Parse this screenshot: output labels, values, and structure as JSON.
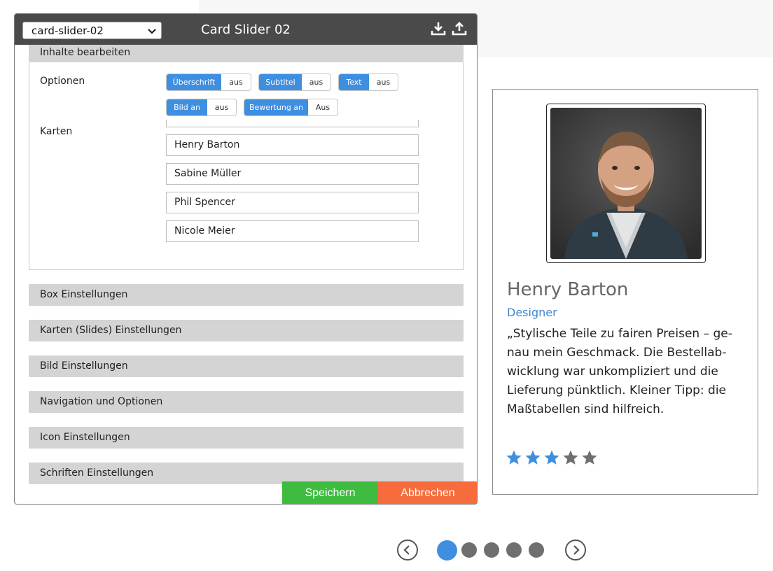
{
  "editor": {
    "preset_select": "card-slider-02",
    "title": "Card Slider 02",
    "sections": {
      "content": "Inhalte bearbeiten",
      "box": "Box Einstellungen",
      "slides": "Karten (Slides) Einstellungen",
      "image": "Bild Einstellungen",
      "navigation": "Navigation und Optionen",
      "icon": "Icon Einstellungen",
      "fonts": "Schriften Einstellungen"
    },
    "options_label": "Optionen",
    "cards_label": "Karten",
    "toggles": [
      {
        "on": "Überschrift",
        "off": "aus"
      },
      {
        "on": "Subtitel",
        "off": "aus"
      },
      {
        "on": "Text",
        "off": "aus"
      },
      {
        "on": "Bild an",
        "off": "aus"
      },
      {
        "on": "Bewertung an",
        "off": "Aus"
      }
    ],
    "cards": [
      "Henry Barton",
      "Sabine Müller",
      "Phil Spencer",
      "Nicole Meier"
    ],
    "save_label": "Speichern",
    "cancel_label": "Abbrechen"
  },
  "preview": {
    "name": "Henry Barton",
    "role": "Designer",
    "quote": "„Stylische Teile zu fairen Preisen – ge­nau mein Geschmack. Die Bestellab­wicklung war unkompliziert und die Lieferung pünktlich. Kleiner Tipp: die Maßtabellen sind hilfreich.",
    "rating": 3,
    "rating_max": 5
  },
  "slider": {
    "dot_count": 5,
    "active_index": 0
  },
  "colors": {
    "accent": "#3f8fe0",
    "save": "#3fbc3f",
    "cancel": "#f76b3c",
    "header": "#4a4a4a",
    "star_active": "#3f8fe0",
    "star_inactive": "#6f6f6f"
  }
}
